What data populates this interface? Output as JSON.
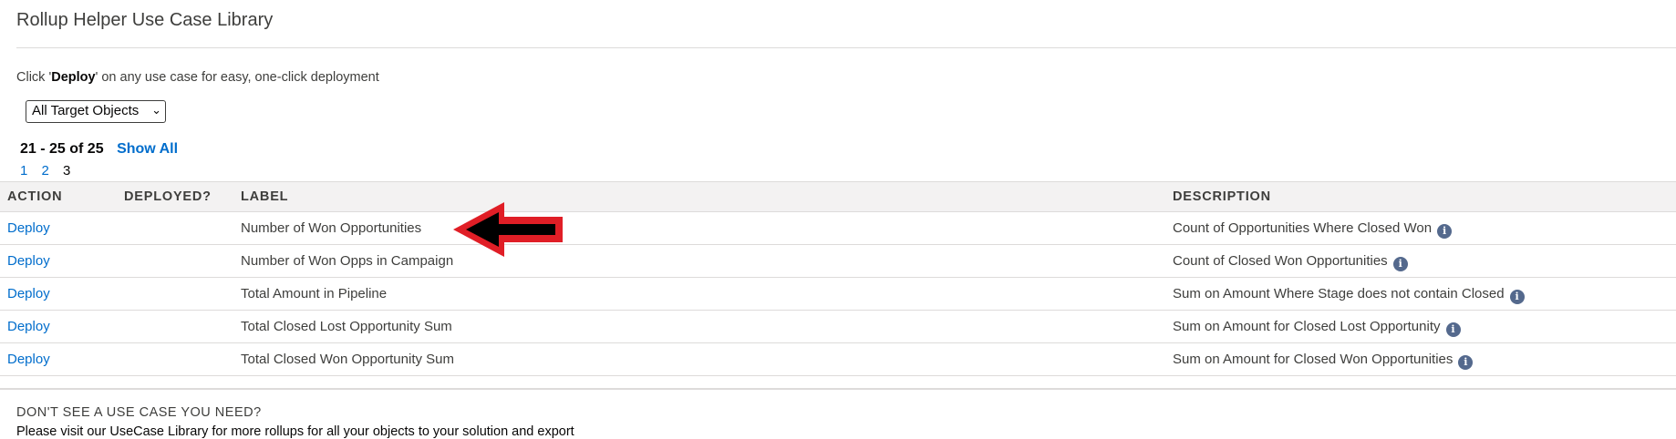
{
  "header": {
    "title": "Rollup Helper Use Case Library"
  },
  "instructions": {
    "prefix": "Click '",
    "bold": "Deploy",
    "suffix": "' on any use case for easy, one-click deployment"
  },
  "filter": {
    "selected": "All Target Objects"
  },
  "paging": {
    "range": "21 - 25 of 25",
    "show_all": "Show All",
    "pages": [
      "1",
      "2",
      "3"
    ],
    "current": "3"
  },
  "table": {
    "headers": {
      "action": "ACTION",
      "deployed": "DEPLOYED?",
      "label": "LABEL",
      "description": "DESCRIPTION"
    },
    "rows": [
      {
        "action": "Deploy",
        "deployed": "",
        "label": "Number of Won Opportunities",
        "description": "Count of Opportunities Where Closed Won"
      },
      {
        "action": "Deploy",
        "deployed": "",
        "label": "Number of Won Opps in Campaign",
        "description": "Count of Closed Won Opportunities"
      },
      {
        "action": "Deploy",
        "deployed": "",
        "label": "Total Amount in Pipeline",
        "description": "Sum on Amount Where Stage does not contain Closed"
      },
      {
        "action": "Deploy",
        "deployed": "",
        "label": "Total Closed Lost Opportunity Sum",
        "description": "Sum on Amount for Closed Lost Opportunity"
      },
      {
        "action": "Deploy",
        "deployed": "",
        "label": "Total Closed Won Opportunity Sum",
        "description": "Sum on Amount for Closed Won Opportunities"
      }
    ]
  },
  "footer": {
    "heading": "DON'T SEE A USE CASE YOU NEED?",
    "text": "Please visit our UseCase Library for more rollups for all your objects to your solution and export"
  },
  "annotation": {
    "arrow_color": "#e01e26",
    "arrow_inner": "#000000"
  },
  "colors": {
    "link": "#006dcc",
    "info_icon": "#54698d",
    "header_bg": "#f3f2f2"
  }
}
